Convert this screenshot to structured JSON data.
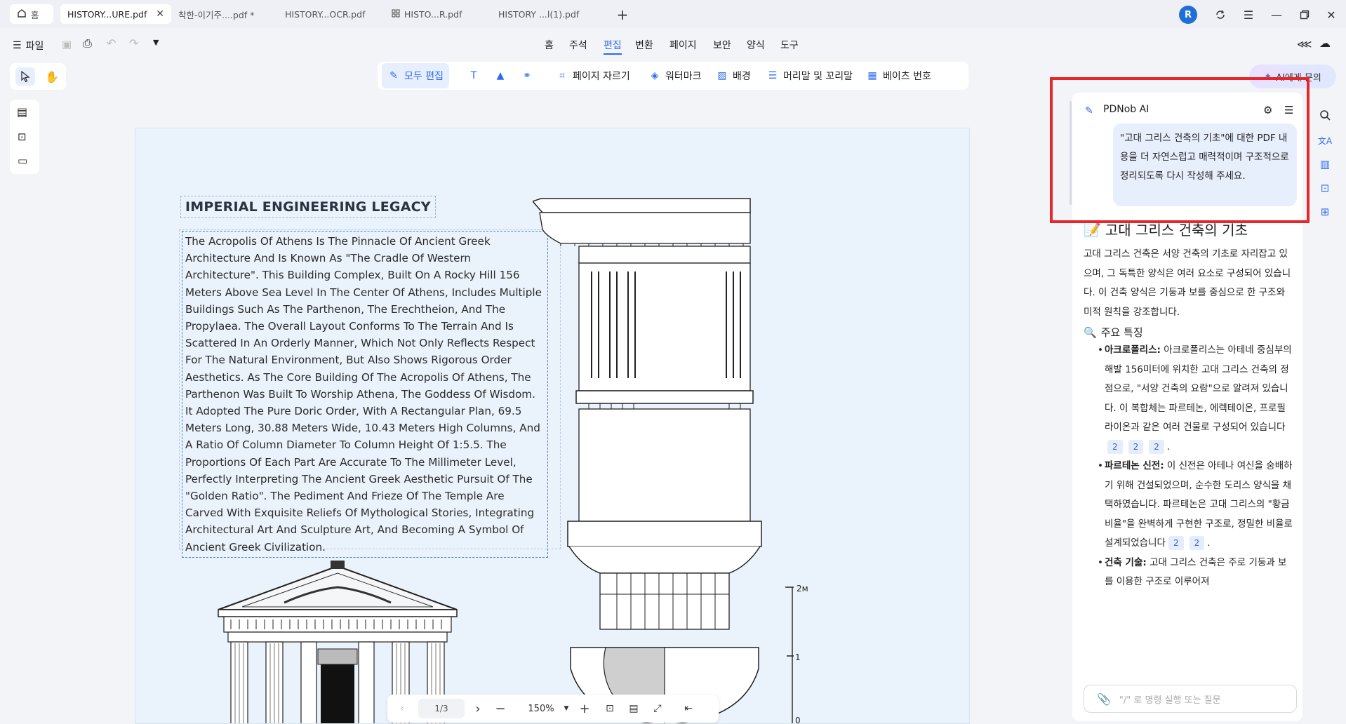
{
  "tabs": [
    {
      "label": "홈",
      "icon": "home-icon"
    },
    {
      "label": "HISTORY...URE.pdf",
      "active": true
    },
    {
      "label": "착한-이기주....pdf *"
    },
    {
      "label": "HISTORY...OCR.pdf"
    },
    {
      "label": "HISTO...R.pdf"
    },
    {
      "label": "HISTORY ...l(1).pdf"
    }
  ],
  "avatar_letter": "R",
  "file_menu": "파일",
  "menu": [
    "홈",
    "주석",
    "편집",
    "변환",
    "페이지",
    "보안",
    "양식",
    "도구"
  ],
  "menu_active": "편집",
  "edit_tools": [
    {
      "label": "모두 편집",
      "active": true
    },
    {
      "label": "페이지 자르기"
    },
    {
      "label": "워터마크"
    },
    {
      "label": "배경"
    },
    {
      "label": "머리말 및 꼬리말"
    },
    {
      "label": "베이츠 번호"
    }
  ],
  "document": {
    "title": "IMPERIAL ENGINEERING LEGACY",
    "body": "The Acropolis Of Athens Is The Pinnacle Of Ancient Greek Architecture And Is Known As \"The Cradle Of Western Architecture\". This Building Complex, Built On A Rocky Hill 156 Meters Above Sea Level In The Center Of Athens, Includes Multiple Buildings Such As The Parthenon, The Erechtheion, And The Propylaea. The Overall Layout Conforms To The Terrain And Is Scattered In An Orderly Manner, Which Not Only Reflects Respect For The Natural Environment, But Also Shows Rigorous Order Aesthetics. As The Core Building Of The Acropolis Of Athens, The Parthenon Was Built To Worship Athena, The Goddess Of Wisdom. It Adopted The Pure Doric Order, With A Rectangular Plan, 69.5 Meters Long, 30.88 Meters Wide, 10.43 Meters High Columns, And A Ratio Of Column Diameter To Column Height Of 1:5.5. The Proportions Of Each Part Are Accurate To The Millimeter Level, Perfectly Interpreting The Ancient Greek Aesthetic Pursuit Of The \"Golden Ratio\". The Pediment And Frieze Of The Temple Are Carved With Exquisite Reliefs Of Mythological Stories, Integrating Architectural Art And Sculpture Art, And Becoming A Symbol Of Ancient Greek Civilization.",
    "scale_labels": [
      "2м",
      "1",
      "0"
    ]
  },
  "page_nav": {
    "page": "1/3",
    "zoom": "150%"
  },
  "ai": {
    "ask_button": "AI에게 문의",
    "panel_title": "PDNob AI",
    "user_prompt": "\"고대 그리스 건축의 기초\"에 대한 PDF 내용을 더 자연스럽고 매력적이며 구조적으로 정리되도록 다시 작성해 주세요.",
    "heading": "고대 그리스 건축의 기초",
    "intro": "고대 그리스 건축은 서양 건축의 기초로 자리잡고 있으며, 그 독특한 양식은 여러 요소로 구성되어 있습니다. 이 건축 양식은 기둥과 보를 중심으로 한 구조와 미적 원칙을 강조합니다.",
    "section_title": "주요 특징",
    "items": [
      {
        "term": "아크로폴리스:",
        "text": "아크로폴리스는 아테네 중심부의 해발 156미터에 위치한 고대 그리스 건축의 정점으로, \"서양 건축의 요람\"으로 알려져 있습니다. 이 복합체는 파르테논, 에렉테이온, 프로필라이온과 같은 여러 건물로 구성되어 있습니다",
        "refs": [
          "2",
          "2",
          "2"
        ]
      },
      {
        "term": "파르테논 신전:",
        "text": "이 신전은 아테나 여신을 숭배하기 위해 건설되었으며, 순수한 도리스 양식을 채택하였습니다. 파르테논은 고대 그리스의 \"황금 비율\"을 완벽하게 구현한 구조로, 정밀한 비율로 설계되었습니다",
        "refs": [
          "2",
          "2"
        ]
      },
      {
        "term": "건축 기술:",
        "text": "고대 그리스 건축은 주로 기둥과 보를 이용한 구조로 이루어져",
        "refs": []
      }
    ],
    "input_placeholder": "\"/\" 로 명령 실행 또는 질문"
  }
}
